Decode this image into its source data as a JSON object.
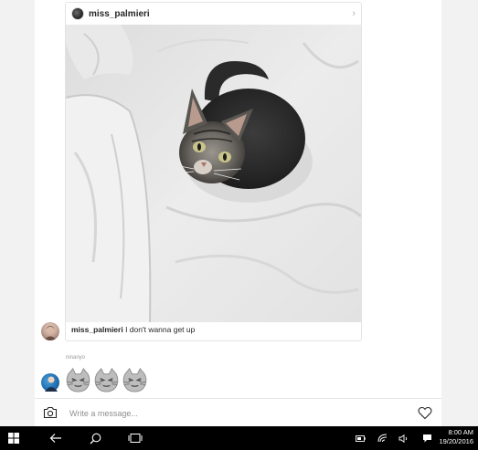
{
  "post": {
    "username": "miss_palmieri",
    "caption_user": "miss_palmieri",
    "caption_text": " I don't wanna get up"
  },
  "thread": {
    "sender_name": "ninanyo",
    "message_emoji_count": 3
  },
  "composer": {
    "placeholder": "Write a message..."
  },
  "taskbar": {
    "time": "8:00 AM",
    "date": "19/20/2016"
  },
  "icons": {
    "start": "windows-icon",
    "back": "back-arrow-icon",
    "search": "search-icon",
    "task_view": "task-view-icon",
    "battery": "battery-icon",
    "wifi": "wifi-icon",
    "volume": "volume-icon",
    "notifications": "notification-icon",
    "camera": "camera-icon",
    "heart": "heart-icon",
    "chevron": "chevron-right-icon"
  }
}
